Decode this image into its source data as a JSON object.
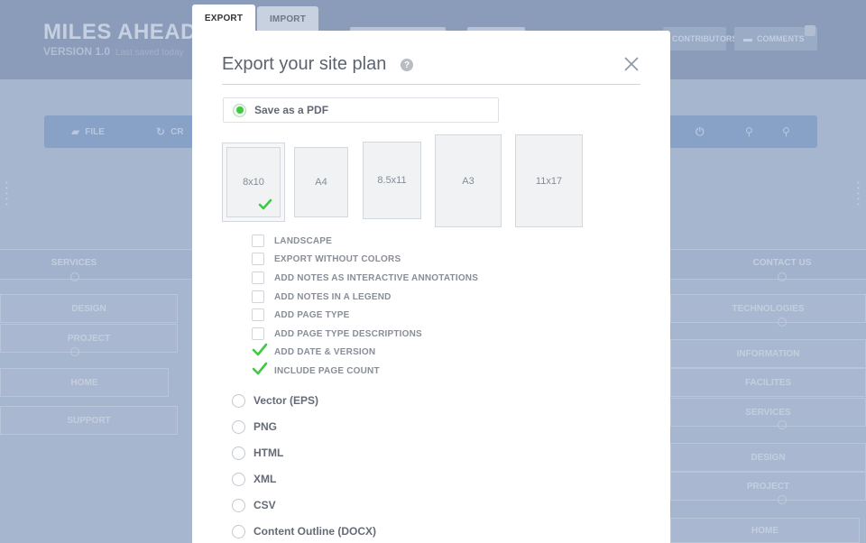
{
  "background": {
    "app_title": "MILES AHEAD",
    "version": "VERSION 1.0",
    "version_sub": "Last saved today",
    "top_buttons": [
      "CONTRIBUTORS",
      "COMMENTS"
    ],
    "toolbar": [
      "FILE",
      "CR"
    ],
    "left_nodes": [
      "SERVICES",
      "DESIGN",
      "PROJECT",
      "HOME",
      "SUPPORT"
    ],
    "right_nodes": [
      "CONTACT US",
      "TECHNOLOGIES",
      "INFORMATION",
      "FACILITES",
      "SERVICES",
      "DESIGN",
      "PROJECT",
      "HOME"
    ]
  },
  "tabs": {
    "export": "EXPORT",
    "import": "IMPORT"
  },
  "modal": {
    "title": "Export your site plan",
    "help": "?",
    "pdf_label": "Save as a PDF",
    "paper_sizes": [
      {
        "label": "8x10",
        "selected": true
      },
      {
        "label": "A4",
        "selected": false
      },
      {
        "label": "8.5x11",
        "selected": false
      },
      {
        "label": "A3",
        "selected": false
      },
      {
        "label": "11x17",
        "selected": false
      }
    ],
    "options": [
      {
        "label": "LANDSCAPE",
        "checked": false
      },
      {
        "label": "EXPORT WITHOUT COLORS",
        "checked": false
      },
      {
        "label": "ADD NOTES AS INTERACTIVE ANNOTATIONS",
        "checked": false
      },
      {
        "label": "ADD NOTES IN A LEGEND",
        "checked": false
      },
      {
        "label": "ADD PAGE TYPE",
        "checked": false
      },
      {
        "label": "ADD PAGE TYPE DESCRIPTIONS",
        "checked": false
      },
      {
        "label": "ADD DATE & VERSION",
        "checked": true
      },
      {
        "label": "INCLUDE PAGE COUNT",
        "checked": true
      }
    ],
    "formats": [
      "Vector (EPS)",
      "PNG",
      "HTML",
      "XML",
      "CSV",
      "Content Outline (DOCX)"
    ]
  },
  "colors": {
    "accent_green": "#42c842",
    "overlay": "#a7b6cf"
  }
}
